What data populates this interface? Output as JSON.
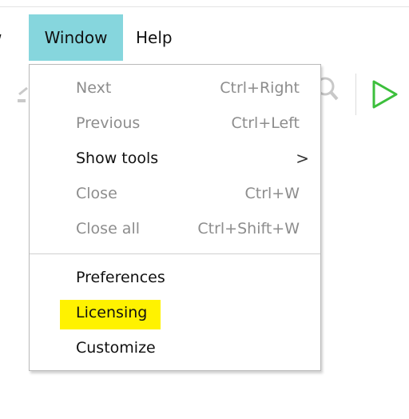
{
  "menubar": {
    "items": [
      {
        "label": "w"
      },
      {
        "label": "Window"
      },
      {
        "label": "Help"
      }
    ]
  },
  "toolbar": {
    "icons": [
      "toolbar-partial-icon",
      "magnifier-icon",
      "run-play-icon"
    ],
    "play_color": "#3cbf3c"
  },
  "window_menu": {
    "items": [
      {
        "label": "Next",
        "shortcut": "Ctrl+Right",
        "enabled": false
      },
      {
        "label": "Previous",
        "shortcut": "Ctrl+Left",
        "enabled": false
      },
      {
        "label": "Show tools",
        "shortcut": "",
        "submenu": true,
        "enabled": true
      },
      {
        "label": "Close",
        "shortcut": "Ctrl+W",
        "enabled": false
      },
      {
        "label": "Close all",
        "shortcut": "Ctrl+Shift+W",
        "enabled": false
      },
      {
        "label": "Preferences",
        "shortcut": "",
        "enabled": true
      },
      {
        "label": "Licensing",
        "shortcut": "",
        "enabled": true,
        "highlighted": true
      },
      {
        "label": "Customize",
        "shortcut": "",
        "enabled": true
      }
    ],
    "submenu_arrow": ">",
    "highlight_color": "#fff200",
    "active_menu_color": "#86d6dd"
  }
}
